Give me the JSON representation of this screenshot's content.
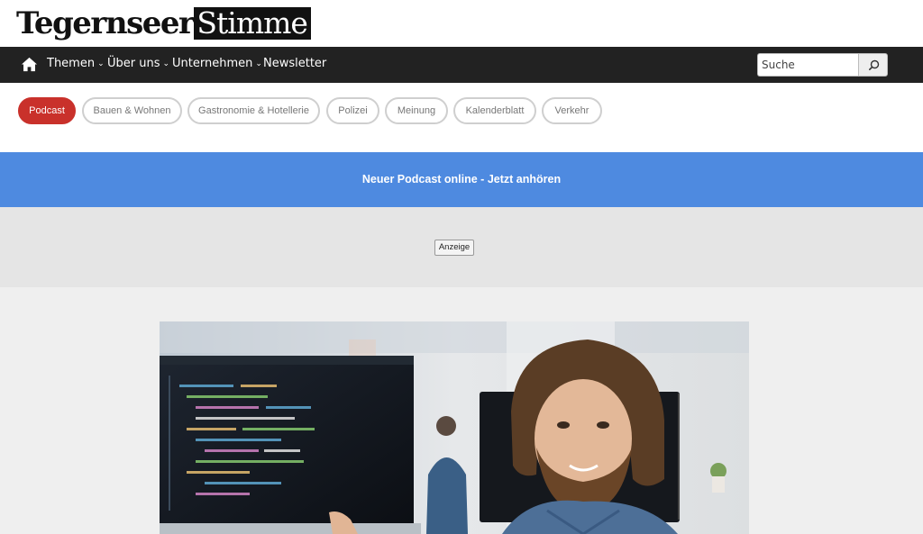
{
  "logo": {
    "part1": "Tegernseer",
    "part2": "Stimme"
  },
  "nav": {
    "items": [
      {
        "label": "Themen",
        "has_dropdown": true
      },
      {
        "label": "Über uns",
        "has_dropdown": true
      },
      {
        "label": "Unternehmen",
        "has_dropdown": true
      },
      {
        "label": "Newsletter",
        "has_dropdown": false
      }
    ],
    "chevron": "⌄",
    "search_placeholder": "Suche",
    "home_icon": "home-icon",
    "search_icon": "magnifier-icon"
  },
  "categories": [
    {
      "label": "Podcast",
      "active": true
    },
    {
      "label": "Bauen & Wohnen",
      "active": false
    },
    {
      "label": "Gastronomie & Hotellerie",
      "active": false
    },
    {
      "label": "Polizei",
      "active": false
    },
    {
      "label": "Meinung",
      "active": false
    },
    {
      "label": "Kalenderblatt",
      "active": false
    },
    {
      "label": "Verkehr",
      "active": false
    }
  ],
  "banner": {
    "text": "Neuer Podcast online - Jetzt anhören"
  },
  "ad": {
    "label": "Anzeige"
  },
  "colors": {
    "nav_bg": "#222222",
    "accent_red": "#c9312b",
    "banner_blue": "#4e8ae0",
    "ad_bg": "#e5e5e5",
    "page_bg": "#efefef"
  }
}
